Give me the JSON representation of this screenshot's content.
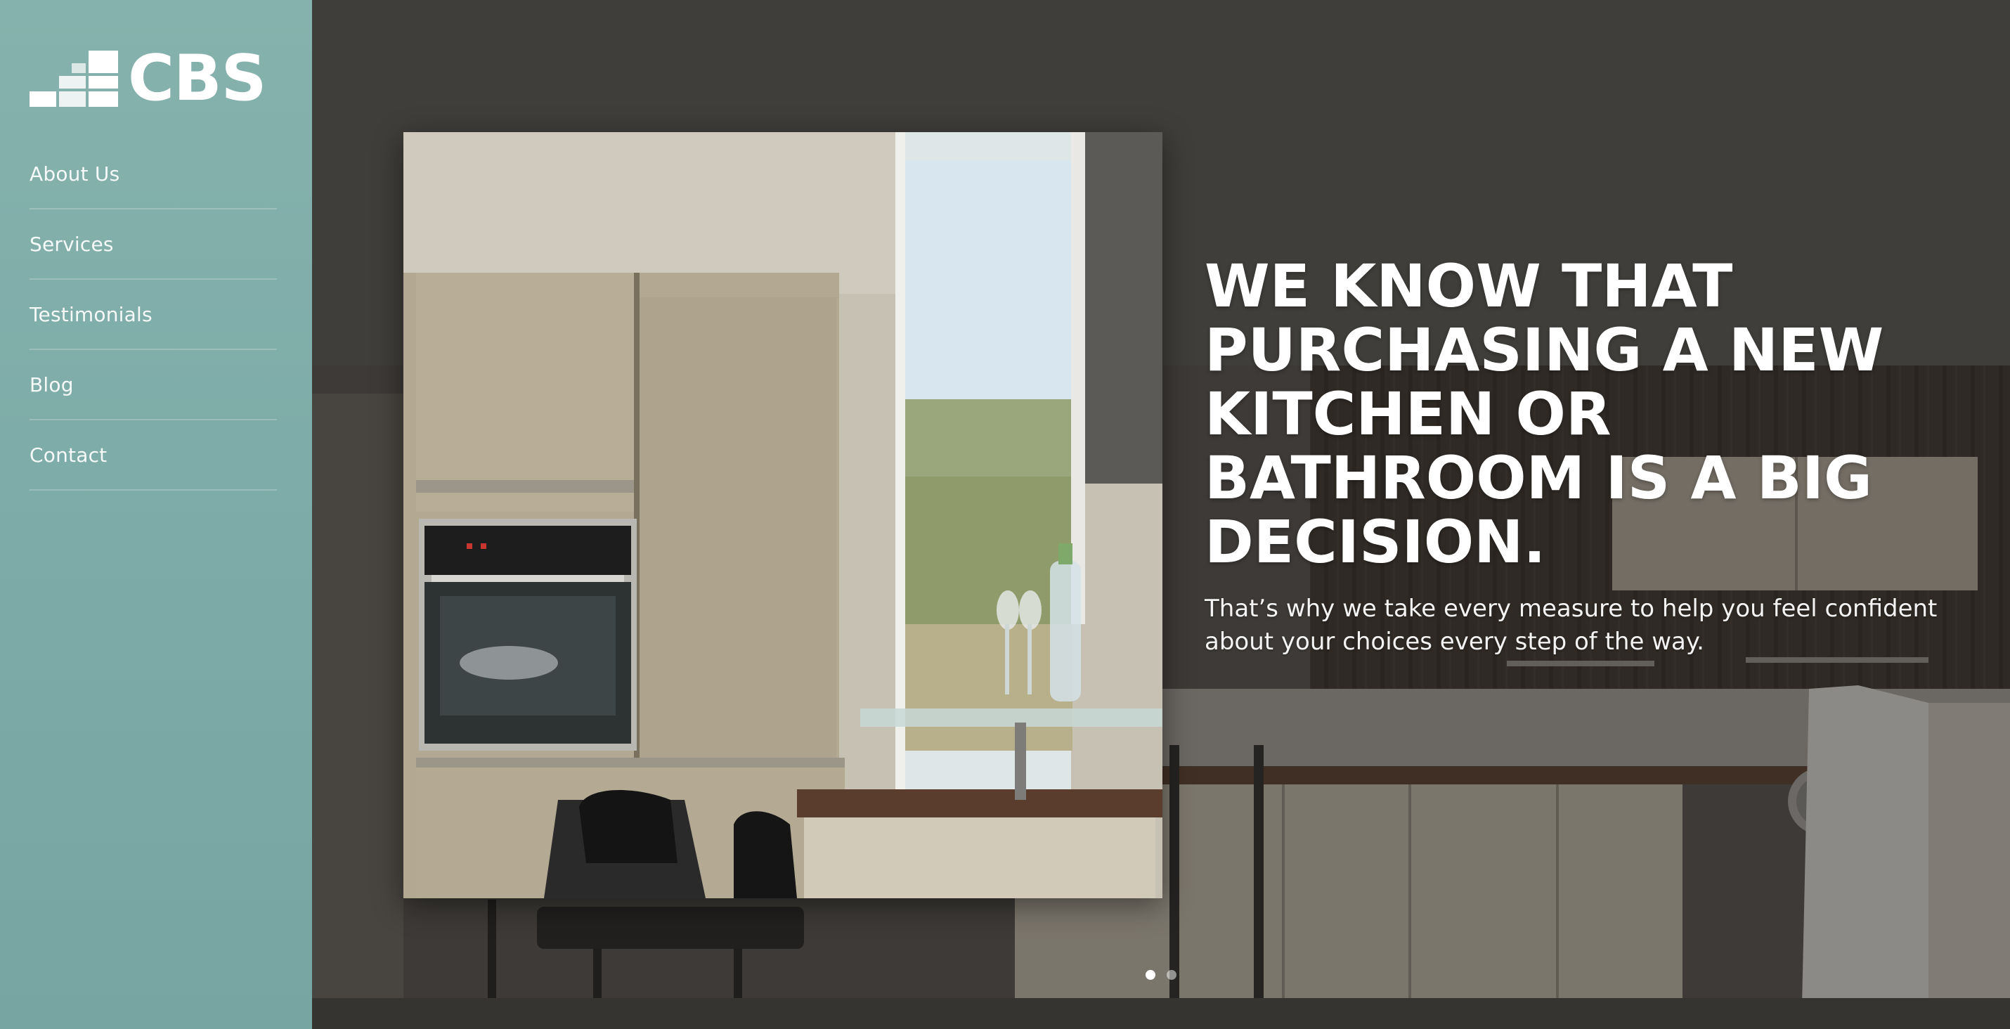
{
  "brand": {
    "name": "CBS",
    "logo_icon": "stepped-bars-logo-icon"
  },
  "sidebar": {
    "items": [
      {
        "label": "About Us"
      },
      {
        "label": "Services"
      },
      {
        "label": "Testimonials"
      },
      {
        "label": "Blog"
      },
      {
        "label": "Contact"
      }
    ]
  },
  "hero": {
    "headline": "We know that purchasing a new kitchen or bathroom is a big decision.",
    "subheadline": "That’s why we take every measure to help you feel confident about your choices every step of the way."
  },
  "slider": {
    "slide_count": 2,
    "active_index": 0
  },
  "colors": {
    "sidebar": "#7eaca8",
    "text": "#ffffff",
    "overlay": "#1e1c1a"
  }
}
